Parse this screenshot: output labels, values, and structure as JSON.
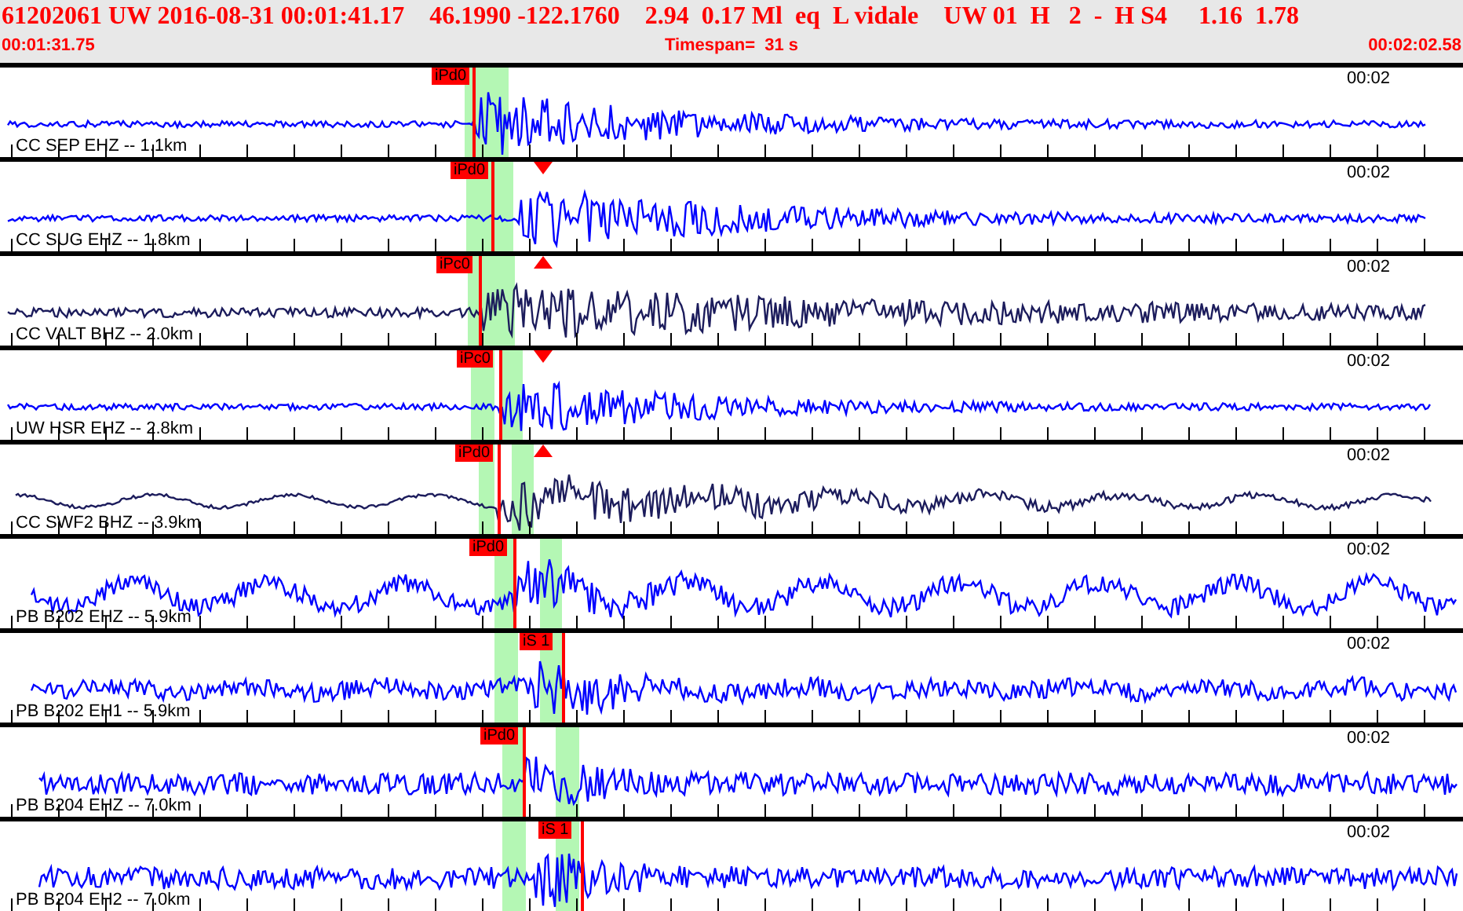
{
  "header": {
    "event_line": "61202061 UW 2016-08-31 00:01:41.17    46.1990 -122.1760    2.94  0.17 Ml  eq  L vidale    UW 01  H   2  -  H S4     1.16  1.78",
    "start_time": "00:01:31.75",
    "timespan": "Timespan=  31 s",
    "end_time": "00:02:02.58"
  },
  "traces": [
    {
      "station": "CC SEP EHZ -- 1.1km",
      "time": "00:02",
      "pick": "iPd0",
      "color": "#0000ff"
    },
    {
      "station": "CC SUG EHZ -- 1.8km",
      "time": "00:02",
      "pick": "iPd0",
      "color": "#0000ff"
    },
    {
      "station": "CC VALT BHZ -- 2.0km",
      "time": "00:02",
      "pick": "iPc0",
      "color": "#1c1c5c"
    },
    {
      "station": "UW HSR EHZ -- 2.8km",
      "time": "00:02",
      "pick": "iPc0",
      "color": "#0000ff"
    },
    {
      "station": "CC SWF2 BHZ -- 3.9km",
      "time": "00:02",
      "pick": "iPd0",
      "color": "#1c1c5c"
    },
    {
      "station": "PB B202 EHZ -- 5.9km",
      "time": "00:02",
      "pick": "iPd0",
      "color": "#0000ff"
    },
    {
      "station": "PB B202 EH1 -- 5.9km",
      "time": "00:02",
      "pick": "iS 1",
      "color": "#0000ff"
    },
    {
      "station": "PB B204 EHZ -- 7.0km",
      "time": "00:02",
      "pick": "iPd0",
      "color": "#0000ff"
    },
    {
      "station": "PB B204 EH2 -- 7.0km",
      "time": "00:02",
      "pick": "iS 1",
      "color": "#0000ff"
    }
  ]
}
